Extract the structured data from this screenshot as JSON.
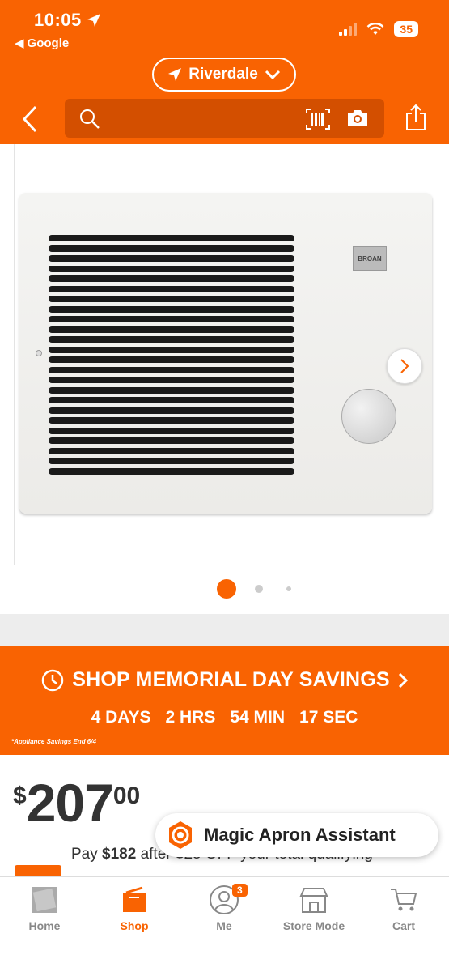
{
  "status_bar": {
    "time": "10:05",
    "back_app": "Google",
    "battery": "35"
  },
  "header": {
    "location": "Riverdale",
    "search_placeholder": ""
  },
  "product_image": {
    "brand_label": "BROAN",
    "image_count": 3,
    "current_image": 1
  },
  "promo": {
    "title": "SHOP MEMORIAL DAY SAVINGS",
    "countdown": {
      "days": "4 DAYS",
      "hours": "2 HRS",
      "minutes": "54 MIN",
      "seconds": "17 SEC"
    },
    "note": "*Appliance Savings End 6/4"
  },
  "price": {
    "currency": "$",
    "dollars": "207",
    "cents": "00",
    "pay_prefix": "Pay ",
    "pay_amount": "$182",
    "pay_suffix": " after $25 OFF your total qualifying"
  },
  "assistant": {
    "label": "Magic Apron Assistant"
  },
  "tabbar": {
    "items": [
      {
        "label": "Home"
      },
      {
        "label": "Shop"
      },
      {
        "label": "Me",
        "badge": "3"
      },
      {
        "label": "Store Mode"
      },
      {
        "label": "Cart"
      }
    ],
    "active": "Shop"
  },
  "colors": {
    "brand_orange": "#f96302",
    "header_search_bg": "#d34f00"
  }
}
